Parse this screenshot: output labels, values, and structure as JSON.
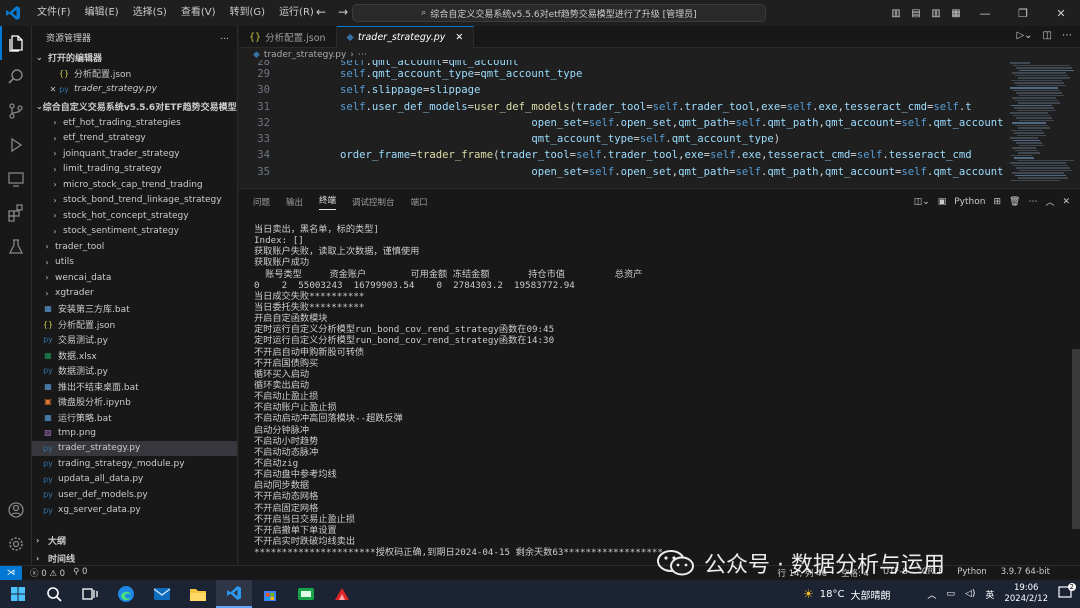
{
  "titlebar": {
    "menus": [
      "文件(F)",
      "编辑(E)",
      "选择(S)",
      "查看(V)",
      "转到(G)",
      "运行(R)"
    ],
    "more": "...",
    "command_center": "综合自定义交易系统v5.5.6对etf趋势交易模型进行了升级 [管理员]"
  },
  "sidebar": {
    "title": "资源管理器",
    "open_editors_label": "打开的编辑器",
    "open_editors": [
      {
        "name": "分析配置.json",
        "icon": "{}",
        "color": "#cbcb41"
      },
      {
        "name": "trader_strategy.py",
        "icon": "py",
        "color": "#3572a5"
      }
    ],
    "project_label": "综合自定义交易系统v5.5.6对ETF趋势交易模型进行了...",
    "folders": [
      "etf_hot_trading_strategies",
      "etf_trend_strategy",
      "joinquant_trader_strategy",
      "limit_trading_strategy",
      "micro_stock_cap_trend_trading",
      "stock_bond_trend_linkage_strategy",
      "stock_hot_concept_strategy",
      "stock_sentiment_strategy"
    ],
    "top_folders": [
      "trader_tool",
      "utils",
      "wencai_data",
      "xgtrader"
    ],
    "files": [
      {
        "name": "安装第三方库.bat",
        "icon": "▦",
        "color": "#5a9bd5"
      },
      {
        "name": "分析配置.json",
        "icon": "{}",
        "color": "#cbcb41"
      },
      {
        "name": "交易测试.py",
        "icon": "py",
        "color": "#3572a5"
      },
      {
        "name": "数据.xlsx",
        "icon": "▦",
        "color": "#1d8f4e"
      },
      {
        "name": "数据测试.py",
        "icon": "py",
        "color": "#3572a5"
      },
      {
        "name": "推出不结束桌面.bat",
        "icon": "▦",
        "color": "#5a9bd5"
      },
      {
        "name": "微盘股分析.ipynb",
        "icon": "▣",
        "color": "#e37933"
      },
      {
        "name": "运行策略.bat",
        "icon": "▦",
        "color": "#5a9bd5"
      },
      {
        "name": "tmp.png",
        "icon": "▨",
        "color": "#a074c4"
      },
      {
        "name": "trader_strategy.py",
        "icon": "py",
        "color": "#3572a5"
      },
      {
        "name": "trading_strategy_module.py",
        "icon": "py",
        "color": "#3572a5"
      },
      {
        "name": "updata_all_data.py",
        "icon": "py",
        "color": "#3572a5"
      },
      {
        "name": "user_def_models.py",
        "icon": "py",
        "color": "#3572a5"
      },
      {
        "name": "xg_server_data.py",
        "icon": "py",
        "color": "#3572a5"
      }
    ],
    "outline_label": "大纲",
    "timeline_label": "时间线"
  },
  "editor": {
    "tabs": [
      {
        "label": "分析配置.json",
        "active": false
      },
      {
        "label": "trader_strategy.py",
        "active": true
      }
    ],
    "breadcrumb": "trader_strategy.py",
    "lines": [
      {
        "no": "28",
        "text": "self.qmt_account=qmt_account",
        "cont": false
      },
      {
        "no": "29",
        "text": "self.qmt_account_type=qmt_account_type",
        "cont": false
      },
      {
        "no": "30",
        "text": "self.slippage=slippage",
        "cont": false
      },
      {
        "no": "31",
        "text": "self.user_def_models=user_def_models(trader_tool=self.trader_tool,exe=self.exe,tesseract_cmd=self.t",
        "cont": false
      },
      {
        "no": "32",
        "text": "                              open_set=self.open_set,qmt_path=self.qmt_path,qmt_account=self.qmt_account",
        "cont": true
      },
      {
        "no": "33",
        "text": "                              qmt_account_type=self.qmt_account_type)",
        "cont": true
      },
      {
        "no": "34",
        "text": "order_frame=trader_frame(trader_tool=self.trader_tool,exe=self.exe,tesseract_cmd=self.tesseract_cmd",
        "cont": false
      },
      {
        "no": "35",
        "text": "                              open_set=self.open_set,qmt_path=self.qmt_path,qmt_account=self.qmt_account",
        "cont": true
      }
    ]
  },
  "panel": {
    "tabs": [
      "问题",
      "输出",
      "终端",
      "调试控制台",
      "端口"
    ],
    "active_tab": "终端",
    "shell_label": "Python",
    "terminal_lines": [
      "当日卖出，黑名单，标的类型]",
      "Index: []",
      "获取账户失败，读取上次数据，谨慎使用",
      "获取账户成功",
      "  账号类型     资金账户        可用金额 冻结金额       持仓市值         总资产",
      "0    2  55003243  16799903.54    0  2784303.2  19583772.94",
      "当日成交失败**********",
      "当日委托失败**********",
      "开启自定函数模块",
      "定时运行自定义分析模型run_bond_cov_rend_strategy函数在09:45",
      "定时运行自定义分析模型run_bond_cov_rend_strategy函数在14:30",
      "不开启自动申购新股可转债",
      "不开启国债购买",
      "循环买入启动",
      "循环卖出启动",
      "不启动止盈止损",
      "不启动账户止盈止损",
      "不启动启动冲高回落模块--超跌反弹",
      "启动分钟脉冲",
      "不启动小时趋势",
      "不启动动态脉冲",
      "不启动zig",
      "不启动盘中参考均线",
      "启动同步数据",
      "不开启动态网格",
      "不开启固定网格",
      "不开启当日交易止盈止损",
      "不开启撤单下单设置",
      "不开启实时跌破均线卖出",
      "**********************授权码正确,到期日2024-04-15 剩余天数63******************"
    ]
  },
  "statusbar": {
    "errors": "0",
    "warnings": "0",
    "ports": "0",
    "position": "行 14, 列 46",
    "spaces": "空格: 4",
    "encoding": "UTF-8",
    "eol": "CRLF",
    "language": "Python",
    "interpreter": "3.9.7 64-bit"
  },
  "watermark": {
    "text": "公众号 · 数据分析与运用"
  },
  "taskbar": {
    "weather_temp": "18°C",
    "weather_text": "大部晴朗",
    "ime": "英",
    "time": "19:06",
    "date": "2024/2/12",
    "notifications": "2"
  },
  "colors": {
    "accent": "#0078d4",
    "code_variable": "#9cdcfe",
    "code_function": "#dcdcaa"
  }
}
